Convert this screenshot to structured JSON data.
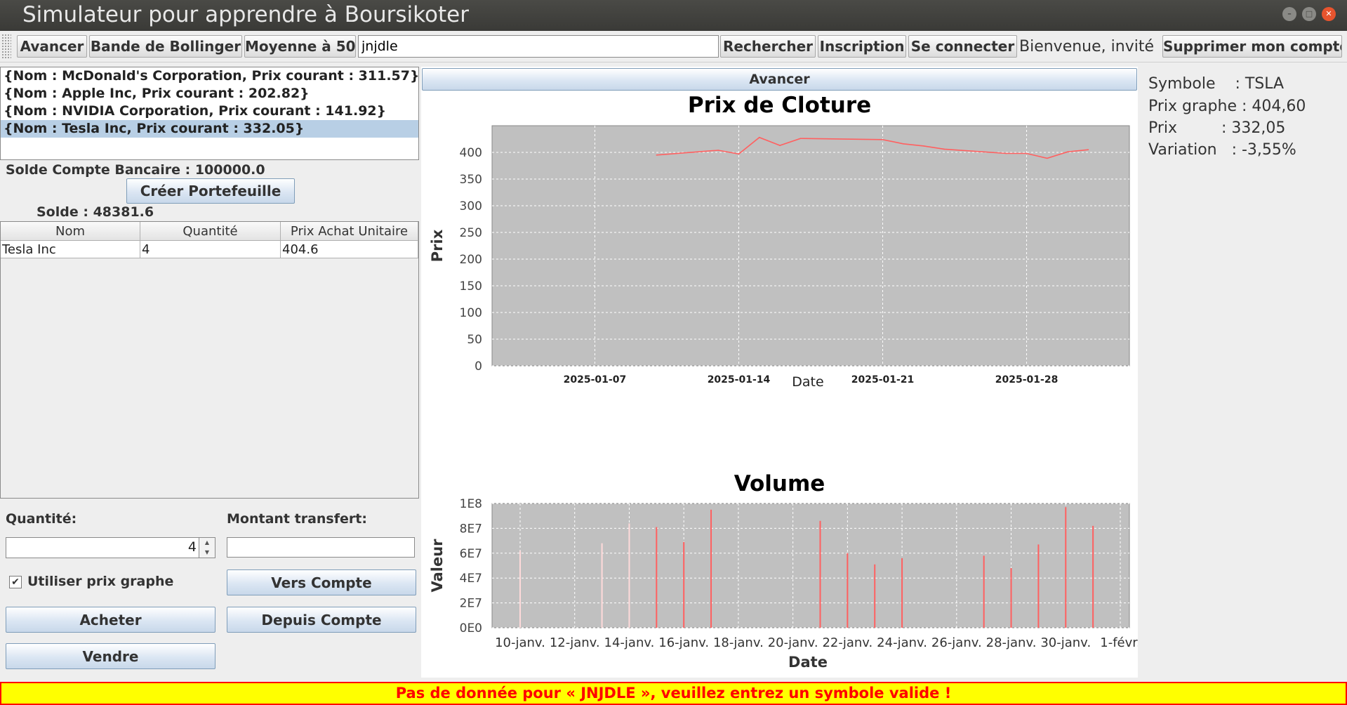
{
  "window": {
    "title": "Simulateur pour apprendre à Boursikoter"
  },
  "toolbar": {
    "avancer": "Avancer",
    "bollinger": "Bande de Bollinger",
    "moyenne": "Moyenne à 50",
    "search_value": "jnjdle",
    "rechercher": "Rechercher",
    "inscription": "Inscription",
    "se_connecter": "Se connecter",
    "welcome": "Bienvenue, invité",
    "supprimer": "Supprimer mon compte"
  },
  "stocks": [
    "{Nom : McDonald's Corporation, Prix courant : 311.57}",
    "{Nom : Apple Inc, Prix courant : 202.82}",
    "{Nom : NVIDIA Corporation, Prix courant : 141.92}",
    "{Nom : Tesla Inc, Prix courant : 332.05}"
  ],
  "account": {
    "solde_bancaire": "Solde Compte Bancaire : 100000.0",
    "creer_portefeuille": "Créer Portefeuille",
    "solde": "Solde : 48381.6"
  },
  "portfolio": {
    "headers": [
      "Nom",
      "Quantité",
      "Prix Achat Unitaire"
    ],
    "rows": [
      [
        "Tesla Inc",
        "4",
        "404.6"
      ]
    ]
  },
  "trade": {
    "quantite_label": "Quantité:",
    "quantite_value": "4",
    "montant_label": "Montant transfert:",
    "utiliser_prix": "Utiliser prix graphe",
    "vers_compte": "Vers Compte",
    "acheter": "Acheter",
    "depuis_compte": "Depuis Compte",
    "vendre": "Vendre"
  },
  "center": {
    "avancer": "Avancer"
  },
  "info": {
    "symbole": "Symbole    : TSLA",
    "prix_graphe": "Prix graphe : 404,60",
    "prix": "Prix         : 332,05",
    "variation": "Variation   : -3,55%"
  },
  "status": "Pas de donnée pour « JNJDLE », veuillez entrez un symbole valide !",
  "colors": {
    "accent_line": "#ff6060",
    "plot_bg": "#c0c0c0",
    "status_bg": "#ffff00",
    "status_text": "#ff0000"
  },
  "chart_data": [
    {
      "type": "line",
      "title": "Prix de Cloture",
      "xlabel": "Date",
      "ylabel": "Prix",
      "ylim": [
        0,
        450
      ],
      "yticks": [
        "0",
        "50",
        "100",
        "150",
        "200",
        "250",
        "300",
        "350",
        "400"
      ],
      "xticks": [
        "2025-01-07",
        "2025-01-14",
        "2025-01-21",
        "2025-01-28"
      ],
      "x": [
        "2025-01-10",
        "2025-01-13",
        "2025-01-14",
        "2025-01-15",
        "2025-01-16",
        "2025-01-17",
        "2025-01-21",
        "2025-01-22",
        "2025-01-23",
        "2025-01-24",
        "2025-01-27",
        "2025-01-28",
        "2025-01-29",
        "2025-01-30",
        "2025-01-31"
      ],
      "values": [
        395,
        404,
        397,
        428,
        413,
        426,
        424,
        416,
        412,
        406,
        398,
        398,
        389,
        401,
        405
      ],
      "grid": true
    },
    {
      "type": "bar",
      "title": "Volume",
      "xlabel": "Date",
      "ylabel": "Valeur",
      "ylim": [
        0,
        100000000
      ],
      "yticks": [
        "0E0",
        "2E7",
        "4E7",
        "6E7",
        "8E7",
        "1E8"
      ],
      "xticks": [
        "10-janv.",
        "12-janv.",
        "14-janv.",
        "16-janv.",
        "18-janv.",
        "20-janv.",
        "22-janv.",
        "24-janv.",
        "26-janv.",
        "28-janv.",
        "30-janv.",
        "1-févr."
      ],
      "x": [
        "2025-01-10",
        "2025-01-13",
        "2025-01-14",
        "2025-01-15",
        "2025-01-16",
        "2025-01-17",
        "2025-01-21",
        "2025-01-22",
        "2025-01-23",
        "2025-01-24",
        "2025-01-27",
        "2025-01-28",
        "2025-01-29",
        "2025-01-30",
        "2025-01-31"
      ],
      "values": [
        62000000,
        68000000,
        84000000,
        81000000,
        69000000,
        95000000,
        86000000,
        60000000,
        51000000,
        56000000,
        58000000,
        48000000,
        67000000,
        97000000,
        82000000
      ],
      "grid": true
    }
  ]
}
